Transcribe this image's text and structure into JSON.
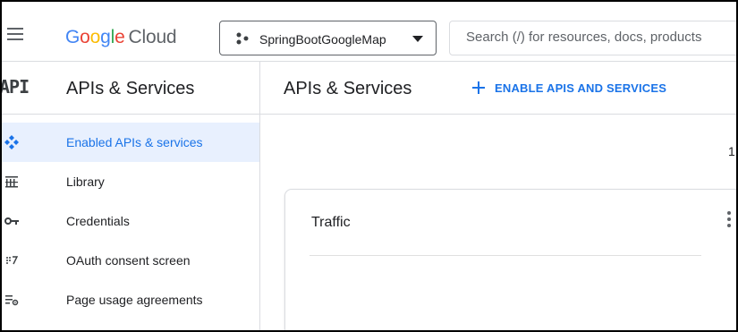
{
  "header": {
    "logo_google": [
      "G",
      "o",
      "o",
      "g",
      "l",
      "e"
    ],
    "logo_cloud": "Cloud",
    "project_name": "SpringBootGoogleMap",
    "search_placeholder": "Search (/) for resources, docs, products"
  },
  "sidebar": {
    "api_glyph": "API",
    "title": "APIs & Services",
    "items": [
      {
        "label": "Enabled APIs & services",
        "icon": "enabled-apis-icon",
        "active": true
      },
      {
        "label": "Library",
        "icon": "library-icon",
        "active": false
      },
      {
        "label": "Credentials",
        "icon": "key-icon",
        "active": false
      },
      {
        "label": "OAuth consent screen",
        "icon": "oauth-consent-icon",
        "active": false
      },
      {
        "label": "Page usage agreements",
        "icon": "page-usage-agreements-icon",
        "active": false
      }
    ]
  },
  "main": {
    "title": "APIs & Services",
    "enable_button": "ENABLE APIS AND SERVICES",
    "right_count": "1",
    "card": {
      "title": "Traffic"
    }
  },
  "colors": {
    "accent": "#1a73e8",
    "active_bg": "#e8f0fe",
    "border": "#dadce0",
    "text": "#202124"
  }
}
